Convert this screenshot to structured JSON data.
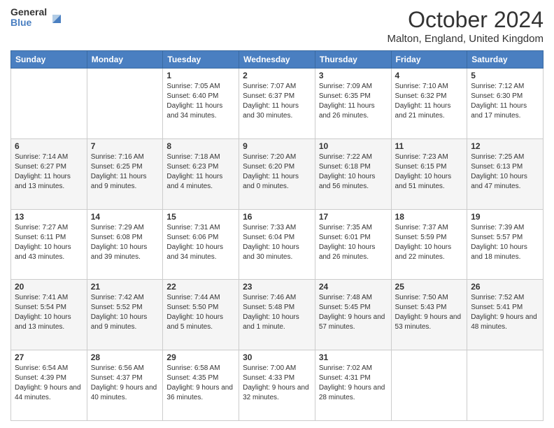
{
  "header": {
    "logo_general": "General",
    "logo_blue": "Blue",
    "month": "October 2024",
    "location": "Malton, England, United Kingdom"
  },
  "days_of_week": [
    "Sunday",
    "Monday",
    "Tuesday",
    "Wednesday",
    "Thursday",
    "Friday",
    "Saturday"
  ],
  "weeks": [
    [
      {
        "day": "",
        "sunrise": "",
        "sunset": "",
        "daylight": ""
      },
      {
        "day": "",
        "sunrise": "",
        "sunset": "",
        "daylight": ""
      },
      {
        "day": "1",
        "sunrise": "Sunrise: 7:05 AM",
        "sunset": "Sunset: 6:40 PM",
        "daylight": "Daylight: 11 hours and 34 minutes."
      },
      {
        "day": "2",
        "sunrise": "Sunrise: 7:07 AM",
        "sunset": "Sunset: 6:37 PM",
        "daylight": "Daylight: 11 hours and 30 minutes."
      },
      {
        "day": "3",
        "sunrise": "Sunrise: 7:09 AM",
        "sunset": "Sunset: 6:35 PM",
        "daylight": "Daylight: 11 hours and 26 minutes."
      },
      {
        "day": "4",
        "sunrise": "Sunrise: 7:10 AM",
        "sunset": "Sunset: 6:32 PM",
        "daylight": "Daylight: 11 hours and 21 minutes."
      },
      {
        "day": "5",
        "sunrise": "Sunrise: 7:12 AM",
        "sunset": "Sunset: 6:30 PM",
        "daylight": "Daylight: 11 hours and 17 minutes."
      }
    ],
    [
      {
        "day": "6",
        "sunrise": "Sunrise: 7:14 AM",
        "sunset": "Sunset: 6:27 PM",
        "daylight": "Daylight: 11 hours and 13 minutes."
      },
      {
        "day": "7",
        "sunrise": "Sunrise: 7:16 AM",
        "sunset": "Sunset: 6:25 PM",
        "daylight": "Daylight: 11 hours and 9 minutes."
      },
      {
        "day": "8",
        "sunrise": "Sunrise: 7:18 AM",
        "sunset": "Sunset: 6:23 PM",
        "daylight": "Daylight: 11 hours and 4 minutes."
      },
      {
        "day": "9",
        "sunrise": "Sunrise: 7:20 AM",
        "sunset": "Sunset: 6:20 PM",
        "daylight": "Daylight: 11 hours and 0 minutes."
      },
      {
        "day": "10",
        "sunrise": "Sunrise: 7:22 AM",
        "sunset": "Sunset: 6:18 PM",
        "daylight": "Daylight: 10 hours and 56 minutes."
      },
      {
        "day": "11",
        "sunrise": "Sunrise: 7:23 AM",
        "sunset": "Sunset: 6:15 PM",
        "daylight": "Daylight: 10 hours and 51 minutes."
      },
      {
        "day": "12",
        "sunrise": "Sunrise: 7:25 AM",
        "sunset": "Sunset: 6:13 PM",
        "daylight": "Daylight: 10 hours and 47 minutes."
      }
    ],
    [
      {
        "day": "13",
        "sunrise": "Sunrise: 7:27 AM",
        "sunset": "Sunset: 6:11 PM",
        "daylight": "Daylight: 10 hours and 43 minutes."
      },
      {
        "day": "14",
        "sunrise": "Sunrise: 7:29 AM",
        "sunset": "Sunset: 6:08 PM",
        "daylight": "Daylight: 10 hours and 39 minutes."
      },
      {
        "day": "15",
        "sunrise": "Sunrise: 7:31 AM",
        "sunset": "Sunset: 6:06 PM",
        "daylight": "Daylight: 10 hours and 34 minutes."
      },
      {
        "day": "16",
        "sunrise": "Sunrise: 7:33 AM",
        "sunset": "Sunset: 6:04 PM",
        "daylight": "Daylight: 10 hours and 30 minutes."
      },
      {
        "day": "17",
        "sunrise": "Sunrise: 7:35 AM",
        "sunset": "Sunset: 6:01 PM",
        "daylight": "Daylight: 10 hours and 26 minutes."
      },
      {
        "day": "18",
        "sunrise": "Sunrise: 7:37 AM",
        "sunset": "Sunset: 5:59 PM",
        "daylight": "Daylight: 10 hours and 22 minutes."
      },
      {
        "day": "19",
        "sunrise": "Sunrise: 7:39 AM",
        "sunset": "Sunset: 5:57 PM",
        "daylight": "Daylight: 10 hours and 18 minutes."
      }
    ],
    [
      {
        "day": "20",
        "sunrise": "Sunrise: 7:41 AM",
        "sunset": "Sunset: 5:54 PM",
        "daylight": "Daylight: 10 hours and 13 minutes."
      },
      {
        "day": "21",
        "sunrise": "Sunrise: 7:42 AM",
        "sunset": "Sunset: 5:52 PM",
        "daylight": "Daylight: 10 hours and 9 minutes."
      },
      {
        "day": "22",
        "sunrise": "Sunrise: 7:44 AM",
        "sunset": "Sunset: 5:50 PM",
        "daylight": "Daylight: 10 hours and 5 minutes."
      },
      {
        "day": "23",
        "sunrise": "Sunrise: 7:46 AM",
        "sunset": "Sunset: 5:48 PM",
        "daylight": "Daylight: 10 hours and 1 minute."
      },
      {
        "day": "24",
        "sunrise": "Sunrise: 7:48 AM",
        "sunset": "Sunset: 5:45 PM",
        "daylight": "Daylight: 9 hours and 57 minutes."
      },
      {
        "day": "25",
        "sunrise": "Sunrise: 7:50 AM",
        "sunset": "Sunset: 5:43 PM",
        "daylight": "Daylight: 9 hours and 53 minutes."
      },
      {
        "day": "26",
        "sunrise": "Sunrise: 7:52 AM",
        "sunset": "Sunset: 5:41 PM",
        "daylight": "Daylight: 9 hours and 48 minutes."
      }
    ],
    [
      {
        "day": "27",
        "sunrise": "Sunrise: 6:54 AM",
        "sunset": "Sunset: 4:39 PM",
        "daylight": "Daylight: 9 hours and 44 minutes."
      },
      {
        "day": "28",
        "sunrise": "Sunrise: 6:56 AM",
        "sunset": "Sunset: 4:37 PM",
        "daylight": "Daylight: 9 hours and 40 minutes."
      },
      {
        "day": "29",
        "sunrise": "Sunrise: 6:58 AM",
        "sunset": "Sunset: 4:35 PM",
        "daylight": "Daylight: 9 hours and 36 minutes."
      },
      {
        "day": "30",
        "sunrise": "Sunrise: 7:00 AM",
        "sunset": "Sunset: 4:33 PM",
        "daylight": "Daylight: 9 hours and 32 minutes."
      },
      {
        "day": "31",
        "sunrise": "Sunrise: 7:02 AM",
        "sunset": "Sunset: 4:31 PM",
        "daylight": "Daylight: 9 hours and 28 minutes."
      },
      {
        "day": "",
        "sunrise": "",
        "sunset": "",
        "daylight": ""
      },
      {
        "day": "",
        "sunrise": "",
        "sunset": "",
        "daylight": ""
      }
    ]
  ]
}
